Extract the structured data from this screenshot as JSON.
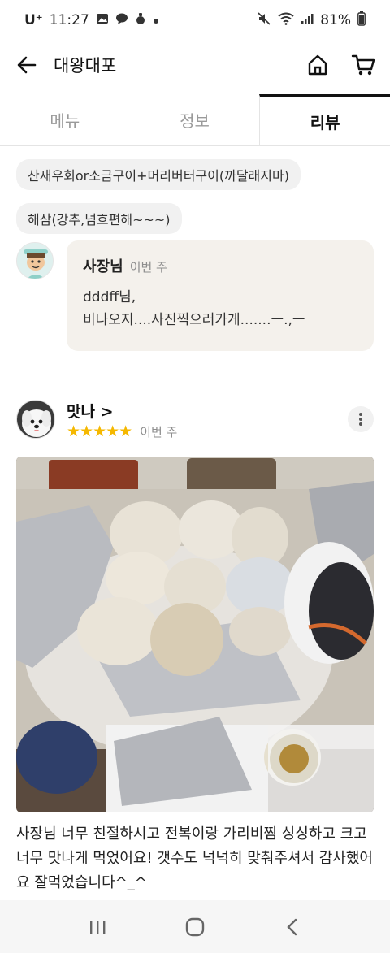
{
  "status_bar": {
    "carrier": "U⁺",
    "time": "11:27",
    "battery": "81%"
  },
  "app_bar": {
    "title": "대왕대포",
    "back_icon": "back-arrow-icon",
    "home_icon": "home-icon",
    "cart_icon": "cart-icon"
  },
  "tabs": [
    {
      "label": "메뉴",
      "active": false
    },
    {
      "label": "정보",
      "active": false
    },
    {
      "label": "리뷰",
      "active": true
    }
  ],
  "ordered_items": [
    "산새우회or소금구이+머리버터구이(까달래지마)",
    "해삼(강추,넘흐편해~~~)"
  ],
  "owner_reply": {
    "name": "사장님",
    "time": "이번 주",
    "text": "dddff님,\n비나오지....사진찍으러가게.......ㅡ.,ㅡ"
  },
  "review": {
    "reviewer": "맛나 >",
    "stars": "★★★★★",
    "rating": 5,
    "time": "이번 주",
    "text": "사장님 너무 친절하시고 전복이랑 가리비찜 싱싱하고 크고 너무 맛나게 먹었어요! 갯수도 넉넉히 맞춰주셔서 감사했어요 잘먹었습니다^_^"
  },
  "colors": {
    "star": "#f5b800",
    "reply_bubble": "#f4f1ec",
    "chip_bg": "#f1f1f1",
    "active_tab": "#111111",
    "inactive_tab": "#9a9a9a"
  }
}
